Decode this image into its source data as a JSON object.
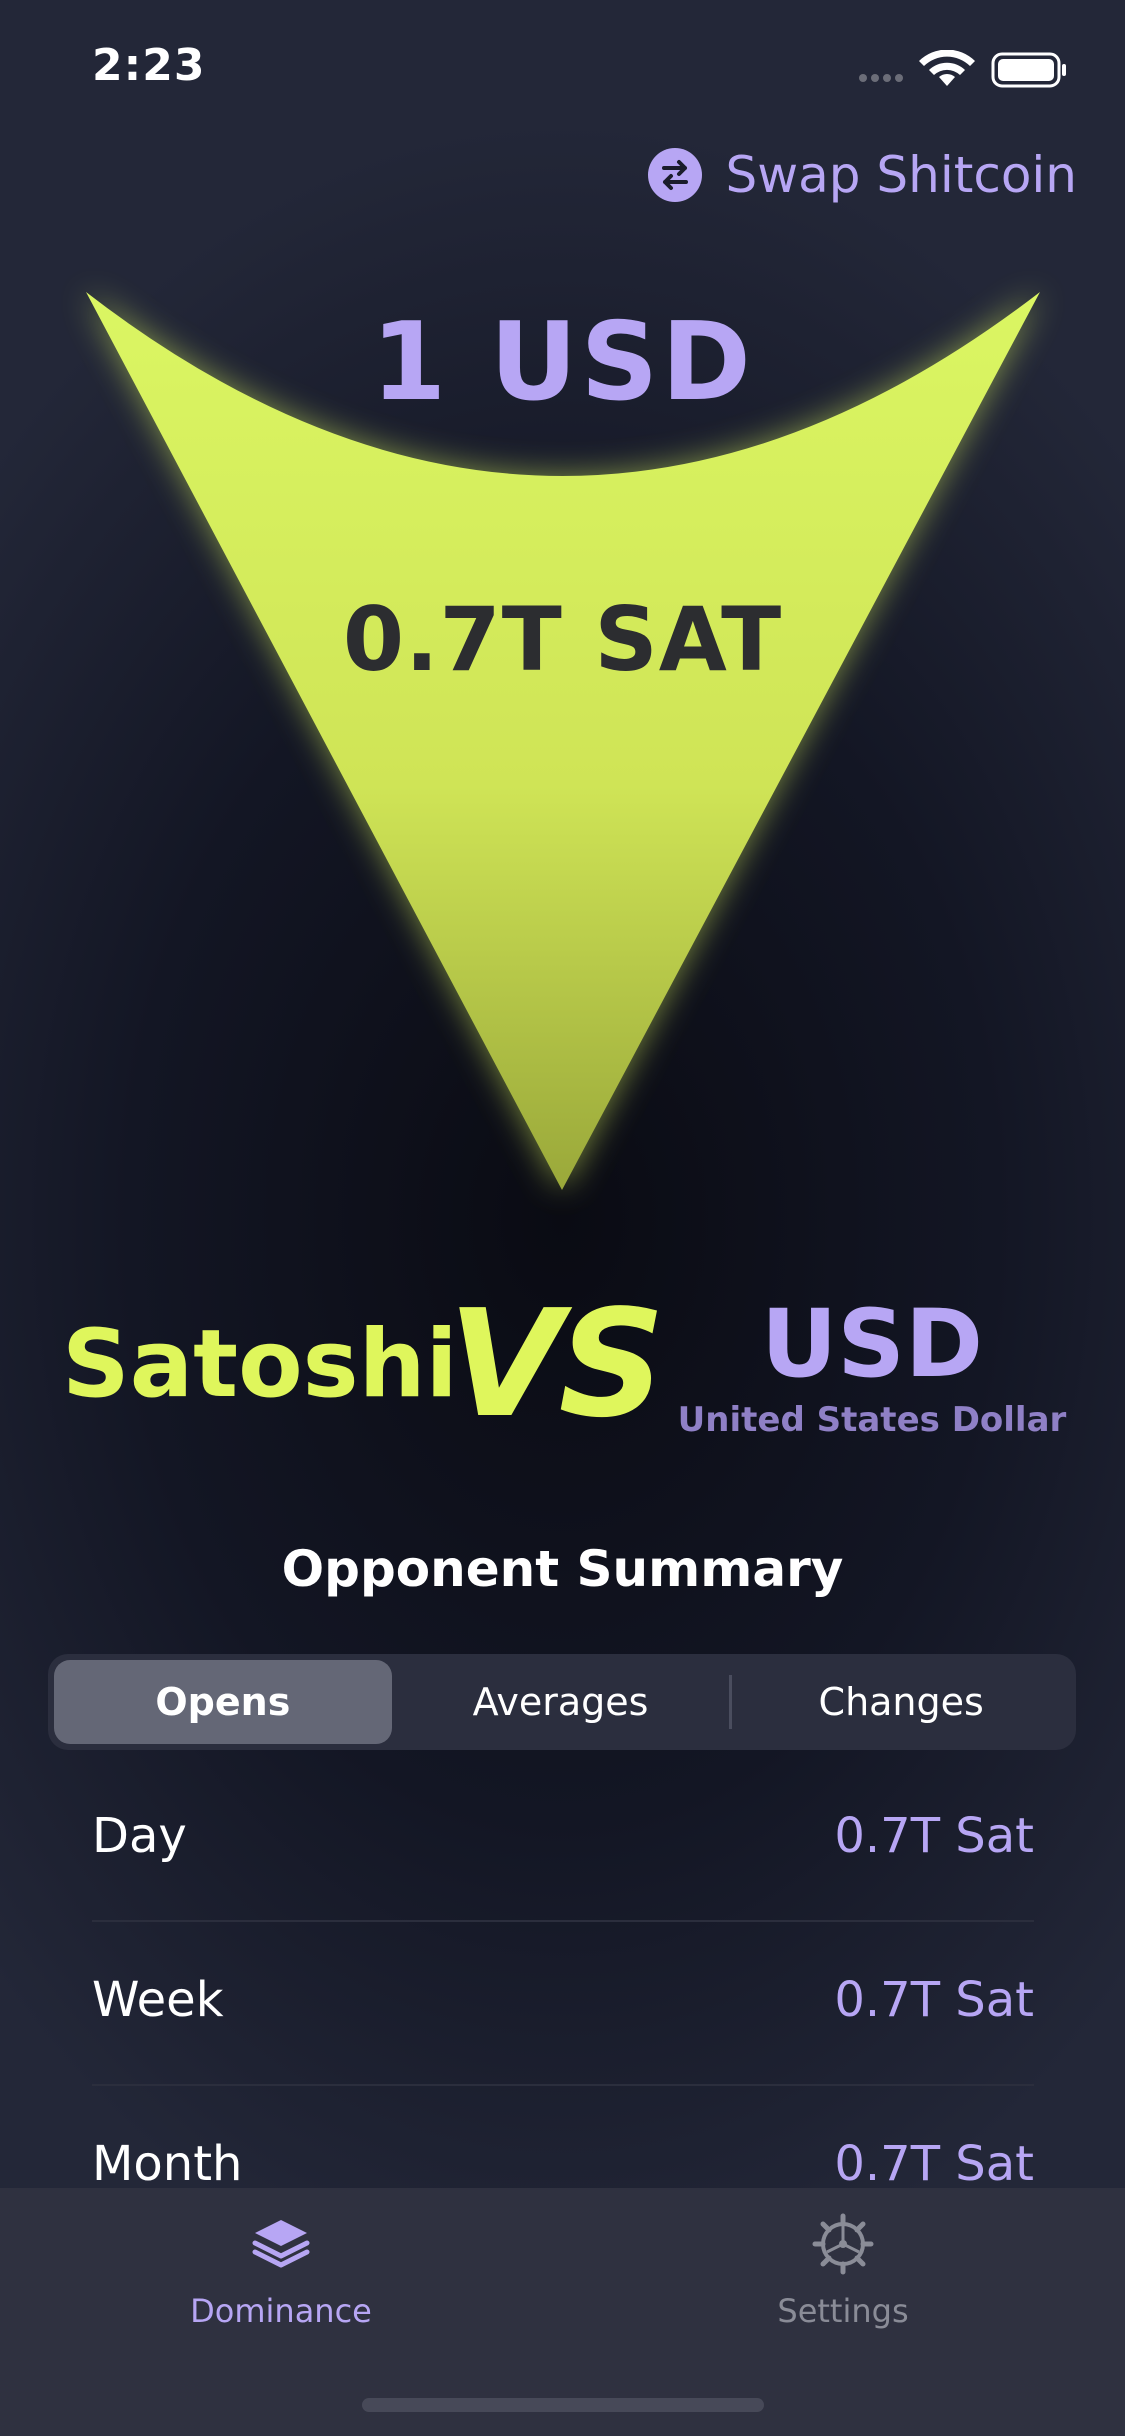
{
  "status_bar": {
    "time": "2:23"
  },
  "header": {
    "swap_label": "Swap Shitcoin"
  },
  "hero": {
    "opponent_amount": "1 USD",
    "sat_amount": "0.7T SAT"
  },
  "versus": {
    "left_name": "Satoshi",
    "vs_label": "VS",
    "right_code": "USD",
    "right_name": "United States Dollar"
  },
  "summary": {
    "title": "Opponent Summary",
    "tabs": [
      {
        "label": "Opens",
        "active": true
      },
      {
        "label": "Averages",
        "active": false
      },
      {
        "label": "Changes",
        "active": false
      }
    ],
    "rows": [
      {
        "label": "Day",
        "value": "0.7T Sat"
      },
      {
        "label": "Week",
        "value": "0.7T Sat"
      },
      {
        "label": "Month",
        "value": "0.7T Sat"
      }
    ]
  },
  "tab_bar": {
    "items": [
      {
        "label": "Dominance",
        "icon": "layers-icon",
        "active": true
      },
      {
        "label": "Settings",
        "icon": "gear-icon",
        "active": false
      }
    ]
  },
  "colors": {
    "accent_purple": "#b7a6f4",
    "accent_lime": "#dff65c",
    "background": "#171a26"
  }
}
